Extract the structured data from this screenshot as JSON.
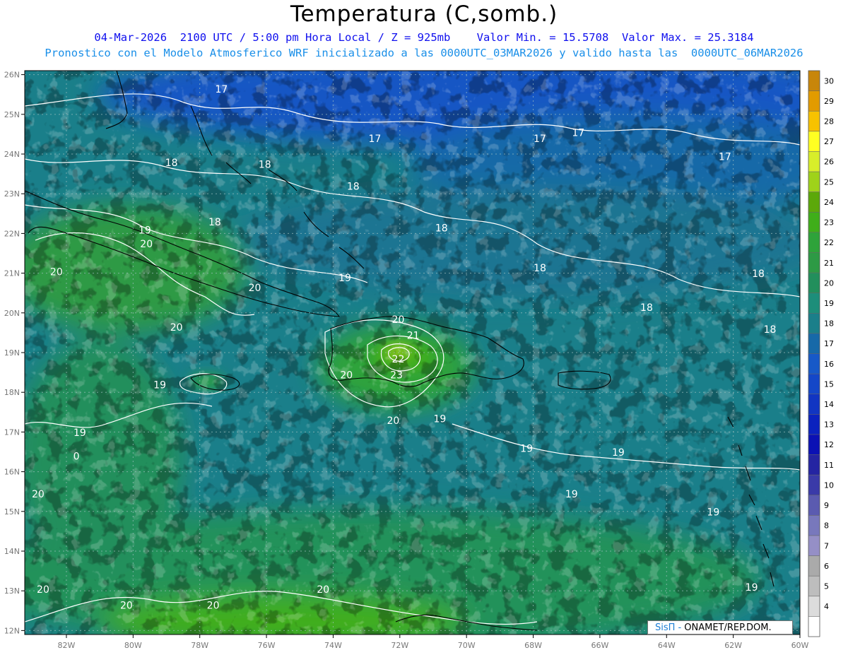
{
  "header": {
    "title": "Temperatura (C,somb.)",
    "line1": "04-Mar-2026  2100 UTC / 5:00 pm Hora Local / Z = 925mb    Valor Min. = 15.5708  Valor Max. = 25.3184",
    "line2": "Pronostico con el Modelo Atmosferico WRF inicializado a las 0000UTC_03MAR2026 y valido hasta las  0000UTC_06MAR2026"
  },
  "map": {
    "lat_labels": [
      "26N",
      "25N",
      "24N",
      "23N",
      "22N",
      "21N",
      "20N",
      "19N",
      "18N",
      "17N",
      "16N",
      "15N",
      "14N",
      "13N",
      "12N"
    ],
    "lon_labels": [
      "82W",
      "80W",
      "78W",
      "76W",
      "74W",
      "72W",
      "70W",
      "68W",
      "66W",
      "64W",
      "62W",
      "60W"
    ],
    "contour_labels": [
      {
        "text": "17",
        "lon": -77.35,
        "lat": 25.55
      },
      {
        "text": "17",
        "lon": -72.75,
        "lat": 24.3
      },
      {
        "text": "17",
        "lon": -67.8,
        "lat": 24.3
      },
      {
        "text": "17",
        "lon": -66.65,
        "lat": 24.45
      },
      {
        "text": "17",
        "lon": -62.25,
        "lat": 23.85
      },
      {
        "text": "18",
        "lon": -78.85,
        "lat": 23.7
      },
      {
        "text": "18",
        "lon": -76.05,
        "lat": 23.65
      },
      {
        "text": "18",
        "lon": -73.4,
        "lat": 23.1
      },
      {
        "text": "18",
        "lon": -77.55,
        "lat": 22.2
      },
      {
        "text": "18",
        "lon": -70.75,
        "lat": 22.05
      },
      {
        "text": "18",
        "lon": -67.8,
        "lat": 21.05
      },
      {
        "text": "18",
        "lon": -64.6,
        "lat": 20.05
      },
      {
        "text": "18",
        "lon": -61.25,
        "lat": 20.9
      },
      {
        "text": "18",
        "lon": -60.9,
        "lat": 19.5
      },
      {
        "text": "19",
        "lon": -79.65,
        "lat": 22.0
      },
      {
        "text": "19",
        "lon": -73.65,
        "lat": 20.8
      },
      {
        "text": "19",
        "lon": -79.2,
        "lat": 18.1
      },
      {
        "text": "19",
        "lon": -81.6,
        "lat": 16.9
      },
      {
        "text": "19",
        "lon": -70.8,
        "lat": 17.25
      },
      {
        "text": "19",
        "lon": -68.2,
        "lat": 16.5
      },
      {
        "text": "19",
        "lon": -65.45,
        "lat": 16.4
      },
      {
        "text": "19",
        "lon": -66.85,
        "lat": 15.35
      },
      {
        "text": "19",
        "lon": -62.6,
        "lat": 14.9
      },
      {
        "text": "19",
        "lon": -61.45,
        "lat": 13.0
      },
      {
        "text": "20",
        "lon": -79.6,
        "lat": 21.65
      },
      {
        "text": "20",
        "lon": -82.3,
        "lat": 20.95
      },
      {
        "text": "20",
        "lon": -76.35,
        "lat": 20.55
      },
      {
        "text": "20",
        "lon": -78.7,
        "lat": 19.55
      },
      {
        "text": "20",
        "lon": -72.05,
        "lat": 19.75
      },
      {
        "text": "20",
        "lon": -73.6,
        "lat": 18.35
      },
      {
        "text": "20",
        "lon": -72.2,
        "lat": 17.2
      },
      {
        "text": "20",
        "lon": -82.85,
        "lat": 15.35
      },
      {
        "text": "20",
        "lon": -82.7,
        "lat": 12.95
      },
      {
        "text": "20",
        "lon": -80.2,
        "lat": 12.55
      },
      {
        "text": "20",
        "lon": -77.6,
        "lat": 12.55
      },
      {
        "text": "20",
        "lon": -74.3,
        "lat": 12.95
      },
      {
        "text": "21",
        "lon": -71.6,
        "lat": 19.35
      },
      {
        "text": "22",
        "lon": -72.05,
        "lat": 18.75
      },
      {
        "text": "23",
        "lon": -72.1,
        "lat": 18.35
      },
      {
        "text": "0",
        "lon": -81.7,
        "lat": 16.3
      }
    ]
  },
  "colorbar": {
    "levels": [
      "30",
      "29",
      "28",
      "27",
      "26",
      "25",
      "24",
      "23",
      "22",
      "21",
      "20",
      "19",
      "18",
      "17",
      "16",
      "15",
      "14",
      "13",
      "12",
      "11",
      "10",
      "9",
      "8",
      "7",
      "6",
      "5",
      "4"
    ],
    "colors": [
      "#c8860a",
      "#e29b00",
      "#f7c200",
      "#ffff22",
      "#d8ee2a",
      "#9fd21a",
      "#5ca80a",
      "#3fae1a",
      "#2ea33a",
      "#2d9a45",
      "#228f5c",
      "#1d8e7a",
      "#1b7f8a",
      "#1769a8",
      "#1759c8",
      "#1447c8",
      "#1135c2",
      "#0b22be",
      "#0b11b4",
      "#2424a2",
      "#3a3aa8",
      "#5b5bb0",
      "#7878bc",
      "#958fc6",
      "#aaaaaa",
      "#bdbdbd",
      "#dcdcdc",
      "#ffffff"
    ]
  },
  "credit": {
    "brand": "SisΠ -",
    "org": "ONAMET/REP.DOM."
  }
}
